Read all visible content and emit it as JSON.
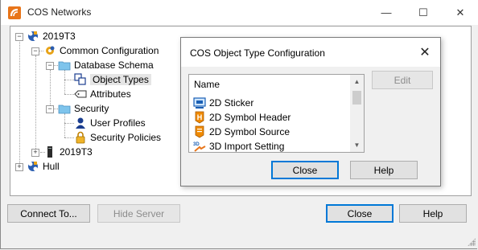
{
  "window": {
    "title": "COS Networks",
    "minimize_glyph": "—",
    "maximize_glyph": "☐",
    "close_glyph": "✕"
  },
  "tree": {
    "root_label": "2019T3",
    "common_config": "Common Configuration",
    "database_schema": "Database Schema",
    "object_types": "Object Types",
    "attributes": "Attributes",
    "security": "Security",
    "user_profiles": "User Profiles",
    "security_policies": "Security Policies",
    "second_2019t3": "2019T3",
    "hull": "Hull"
  },
  "buttons": {
    "connect": "Connect To...",
    "hide_server": "Hide Server",
    "close": "Close",
    "help": "Help"
  },
  "dialog": {
    "title": "COS Object Type Configuration",
    "list_header": "Name",
    "items": [
      "2D Sticker",
      "2D Symbol Header",
      "2D Symbol Source",
      "3D Import Setting"
    ],
    "edit": "Edit",
    "close": "Close",
    "help": "Help"
  },
  "colors": {
    "accent": "#0078d7",
    "logo_orange": "#e8751a",
    "folder": "#7ec4ec"
  }
}
